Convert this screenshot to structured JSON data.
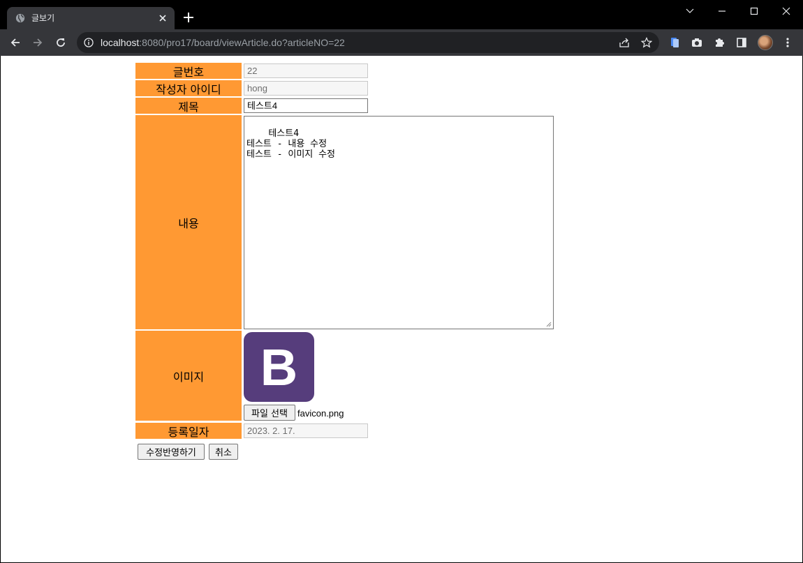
{
  "tab": {
    "title": "글보기"
  },
  "address": {
    "host": "localhost",
    "rest": ":8080/pro17/board/viewArticle.do?articleNO=22"
  },
  "form": {
    "article_no": {
      "label": "글번호",
      "value": "22"
    },
    "writer": {
      "label": "작성자 아이디",
      "value": "hong"
    },
    "title": {
      "label": "제목",
      "value": "테스트4"
    },
    "content": {
      "label": "내용",
      "value": "테스트4\n테스트 - 내용 수정\n테스트 - 이미지 수정"
    },
    "image": {
      "label": "이미지",
      "file_button": "파일 선택",
      "file_name": "favicon.png"
    },
    "reg_date": {
      "label": "등록일자",
      "value": "2023. 2. 17."
    }
  },
  "buttons": {
    "submit": "수정반영하기",
    "cancel": "취소"
  },
  "colors": {
    "label_bg": "#ff9933",
    "image_bg": "#563d7c"
  }
}
